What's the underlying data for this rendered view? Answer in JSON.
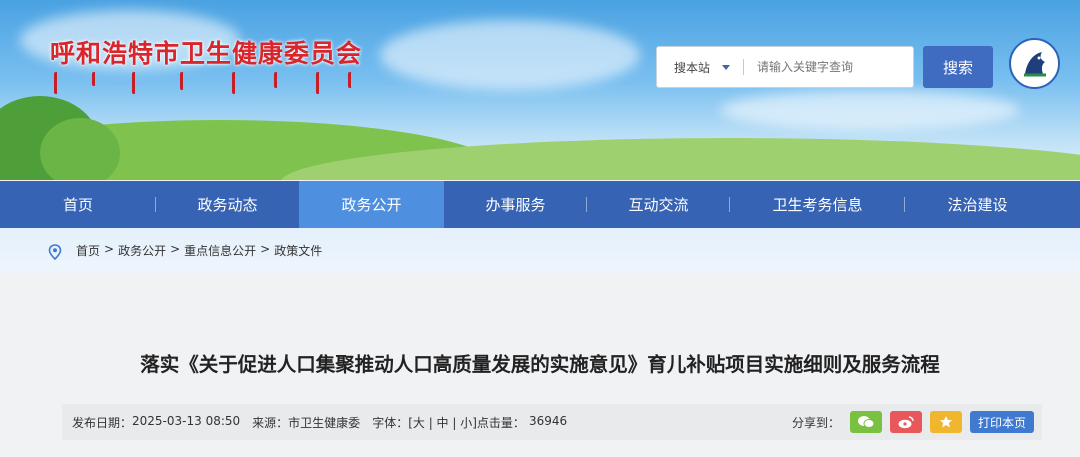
{
  "header": {
    "site_title": "呼和浩特市卫生健康委员会",
    "search": {
      "site_option": "搜本站",
      "placeholder": "请输入关键字查询",
      "button_label": "搜索"
    }
  },
  "nav": {
    "items": [
      {
        "label": "首页"
      },
      {
        "label": "政务动态"
      },
      {
        "label": "政务公开",
        "active": true
      },
      {
        "label": "办事服务"
      },
      {
        "label": "互动交流"
      },
      {
        "label": "卫生考务信息"
      },
      {
        "label": "法治建设"
      }
    ]
  },
  "breadcrumb": [
    "首页",
    ">",
    "政务公开",
    ">",
    "重点信息公开",
    ">",
    "政策文件"
  ],
  "article": {
    "title": "落实《关于促进人口集聚推动人口高质量发展的实施意见》育儿补贴项目实施细则及服务流程",
    "meta": {
      "publish_label": "发布日期：",
      "publish_date": "2025-03-13 08:50",
      "source_label": "来源：",
      "source": "市卫生健康委",
      "font_label": "字体：",
      "font_sizes": "[大 | 中 | 小]",
      "clicks_label": "点击量：",
      "clicks": "36946"
    },
    "share": {
      "label": "分享到：",
      "print_label": "打印本页"
    }
  },
  "colors": {
    "nav_bg": "#3663b3",
    "nav_active": "#4f8fe0",
    "title_red": "#d9262c",
    "wechat": "#7ac142",
    "weibo": "#e8575a",
    "favorite": "#f0b62e",
    "print": "#3f79d0"
  }
}
